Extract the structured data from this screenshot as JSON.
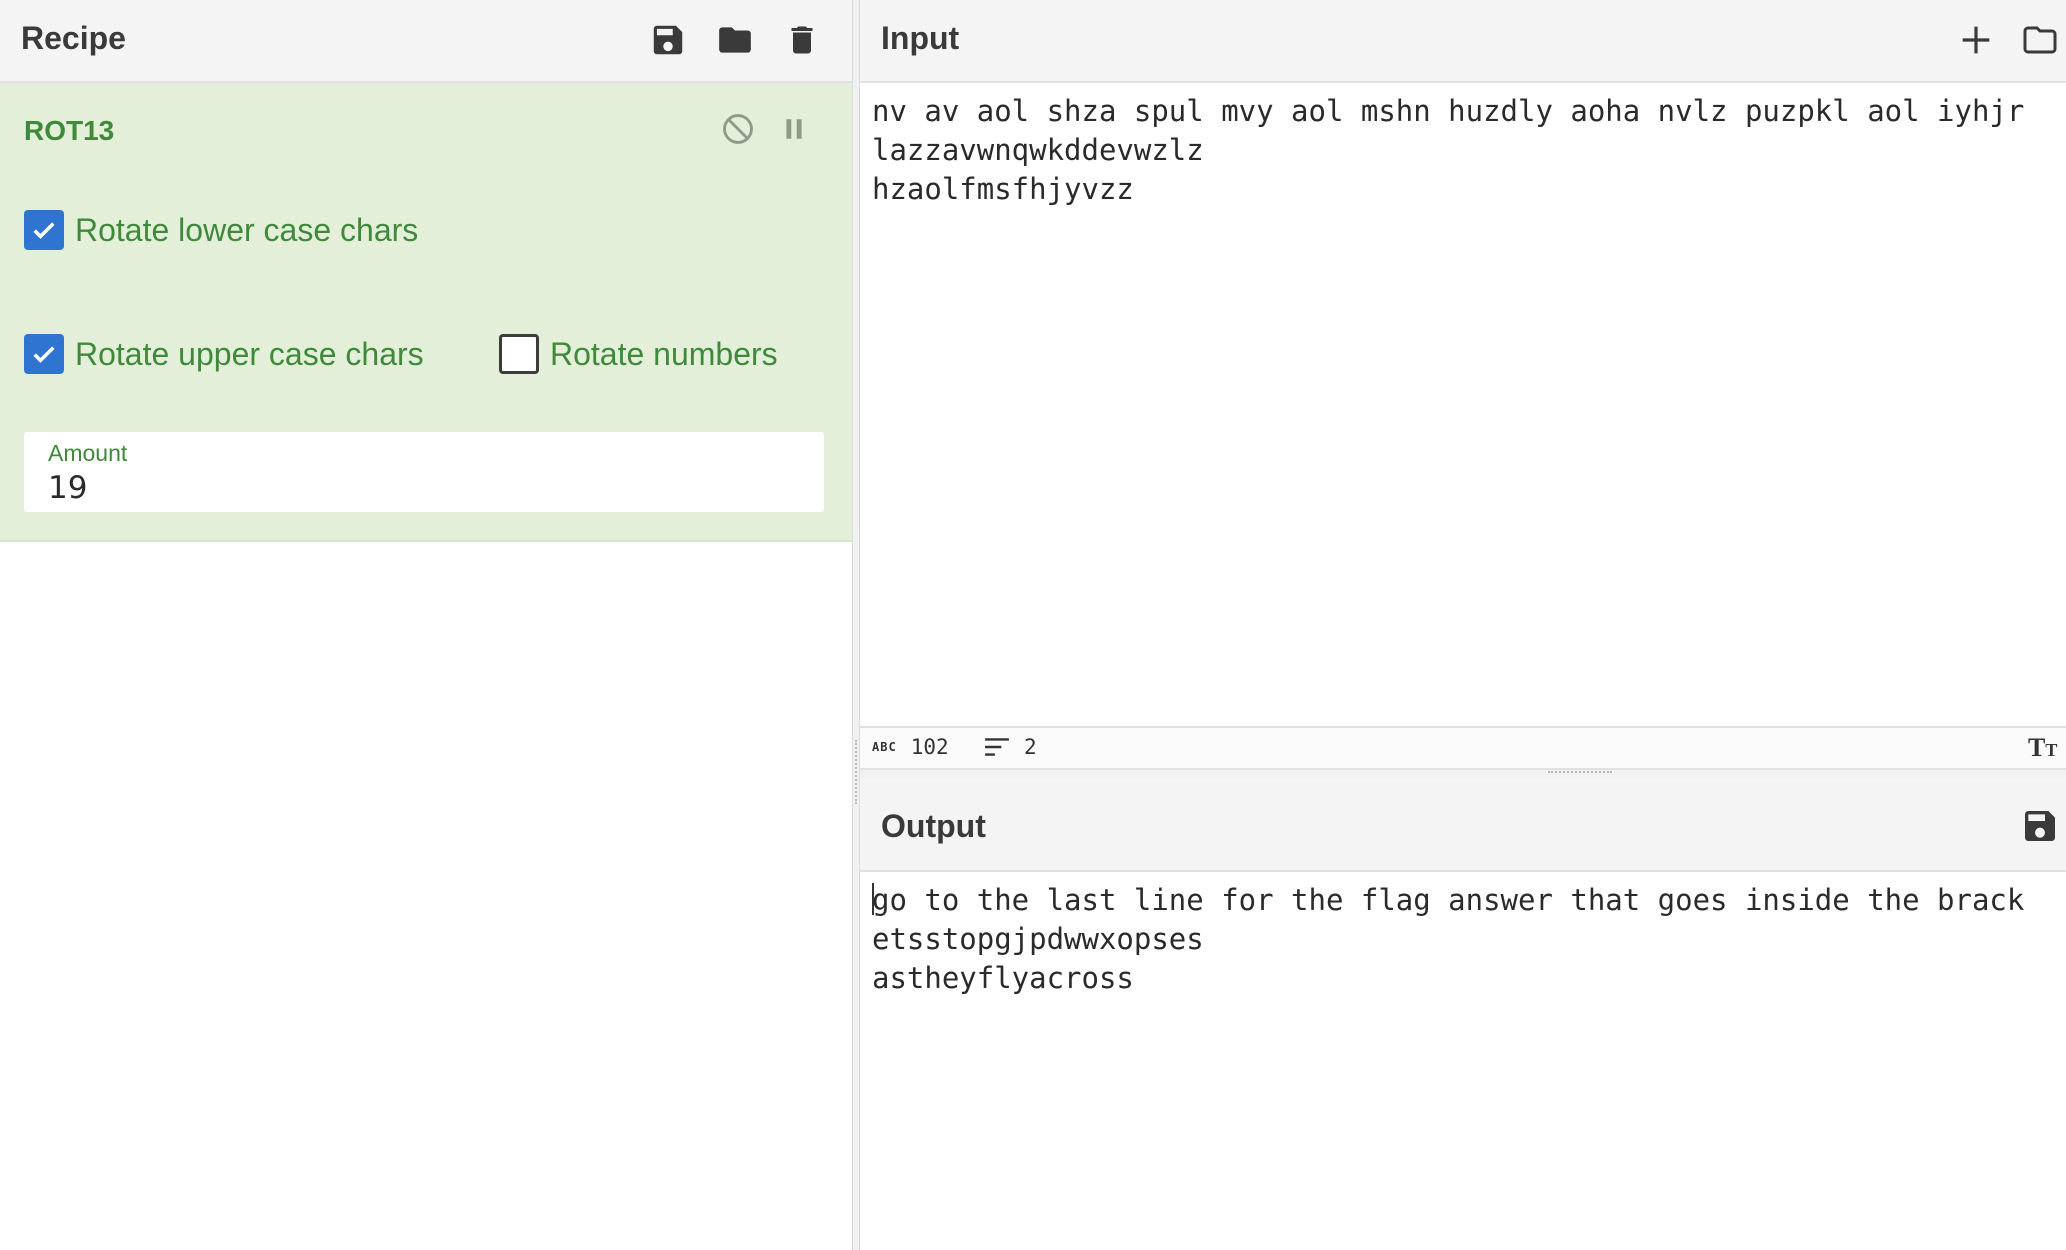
{
  "recipe": {
    "title": "Recipe",
    "buttons": {
      "save": "save-recipe",
      "load": "load-recipe",
      "clear": "clear-recipe"
    }
  },
  "operation": {
    "name": "ROT13",
    "options": [
      {
        "label": "Rotate lower case chars",
        "checked": true
      },
      {
        "label": "Rotate upper case chars",
        "checked": true
      },
      {
        "label": "Rotate numbers",
        "checked": false
      }
    ],
    "amount_label": "Amount",
    "amount_value": "19"
  },
  "input": {
    "title": "Input",
    "lines": [
      "nv av aol shza spul mvy aol mshn huzdly aoha nvlz puzpkl aol iyhjr",
      "lazzavwnqwkddevwzlz",
      "hzaolfmsfhjyvzz"
    ],
    "status": {
      "length": "102",
      "lines": "2"
    }
  },
  "output": {
    "title": "Output",
    "lines": [
      "go to the last line for the flag answer that goes inside the brack",
      "etsstopgjpdwwxopses",
      "astheyflyacross"
    ]
  },
  "colors": {
    "operation_bg": "#e3efd9",
    "operation_text": "#3f8a3a",
    "checkbox_on": "#2f74d0"
  }
}
